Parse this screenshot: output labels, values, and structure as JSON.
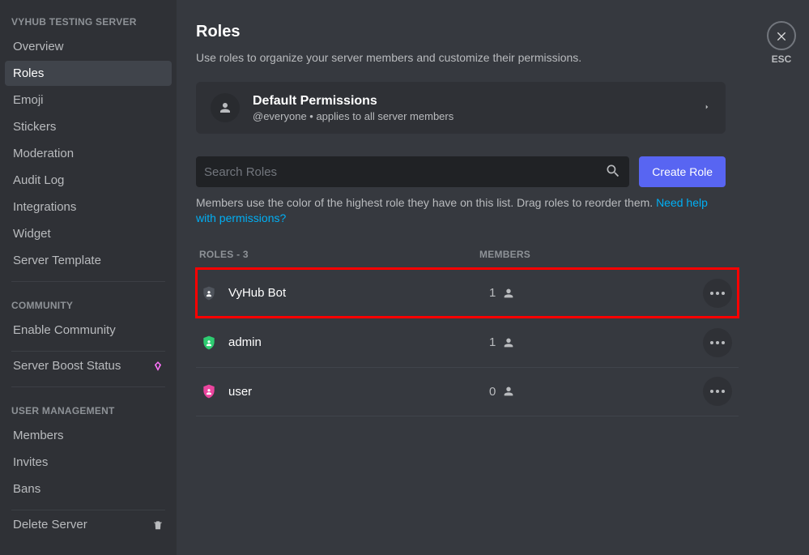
{
  "sidebar": {
    "sections": [
      {
        "header": "VYHUB TESTING SERVER",
        "items": [
          {
            "label": "Overview",
            "active": false
          },
          {
            "label": "Roles",
            "active": true
          },
          {
            "label": "Emoji",
            "active": false
          },
          {
            "label": "Stickers",
            "active": false
          },
          {
            "label": "Moderation",
            "active": false
          },
          {
            "label": "Audit Log",
            "active": false
          },
          {
            "label": "Integrations",
            "active": false
          },
          {
            "label": "Widget",
            "active": false
          },
          {
            "label": "Server Template",
            "active": false
          }
        ]
      },
      {
        "header": "COMMUNITY",
        "items": [
          {
            "label": "Enable Community",
            "active": false
          }
        ]
      },
      {
        "items": [
          {
            "label": "Server Boost Status",
            "active": false,
            "icon": "boost"
          }
        ]
      },
      {
        "header": "USER MANAGEMENT",
        "items": [
          {
            "label": "Members",
            "active": false
          },
          {
            "label": "Invites",
            "active": false
          },
          {
            "label": "Bans",
            "active": false
          }
        ]
      },
      {
        "items": [
          {
            "label": "Delete Server",
            "active": false,
            "icon": "trash"
          }
        ]
      }
    ]
  },
  "close": {
    "esc_label": "ESC"
  },
  "page": {
    "title": "Roles",
    "subtitle": "Use roles to organize your server members and customize their permissions.",
    "default_card": {
      "title": "Default Permissions",
      "sub": "@everyone • applies to all server members"
    },
    "search": {
      "placeholder": "Search Roles"
    },
    "create_label": "Create Role",
    "hint_plain": "Members use the color of the highest role they have on this list. Drag roles to reorder them. ",
    "hint_link": "Need help with permissions?",
    "columns": {
      "roles": "ROLES - 3",
      "members": "MEMBERS"
    },
    "roles": [
      {
        "name": "VyHub Bot",
        "members": 1,
        "color": "#4f545c",
        "highlight": true
      },
      {
        "name": "admin",
        "members": 1,
        "color": "#2ecc71",
        "highlight": false
      },
      {
        "name": "user",
        "members": 0,
        "color": "#eb459e",
        "highlight": false
      }
    ]
  }
}
